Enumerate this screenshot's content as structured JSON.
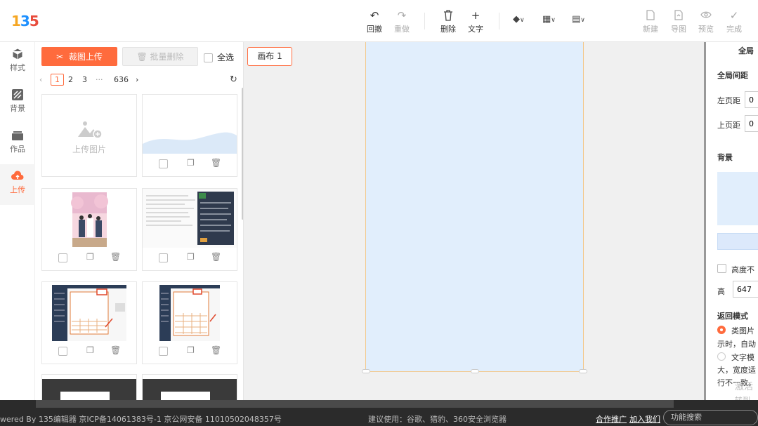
{
  "logo": {
    "text_1": "1",
    "text_2": "3",
    "text_3": "5"
  },
  "toolbar": {
    "undo": "回撤",
    "redo": "重做",
    "delete": "删除",
    "text": "文字",
    "new": "新建",
    "export": "导图",
    "preview": "预览",
    "finish": "完成"
  },
  "leftnav": [
    {
      "label": "样式",
      "icon": "cube-icon"
    },
    {
      "label": "背景",
      "icon": "background-icon"
    },
    {
      "label": "作品",
      "icon": "works-icon"
    },
    {
      "label": "上传",
      "icon": "cloud-upload-icon"
    }
  ],
  "panel": {
    "crop_upload": "裁图上传",
    "batch_delete": "批量删除",
    "select_all": "全选",
    "pager": {
      "pages": [
        "1",
        "2",
        "3"
      ],
      "ellipsis": "···",
      "last": "636",
      "current": "1"
    },
    "upload_placeholder": "上传图片"
  },
  "canvas": {
    "tab_label": "画布 1"
  },
  "right": {
    "title": "全局",
    "spacing_title": "全局间距",
    "left_margin_label": "左页距",
    "left_margin_value": "0",
    "top_margin_label": "上页距",
    "top_margin_value": "0",
    "bg_title": "背景",
    "height_lock_label": "高度不",
    "height_label": "高",
    "height_value": "647",
    "return_mode": "返回模式",
    "mode_image": "类图片",
    "mode_image_desc": "示时，自动",
    "mode_text": "文字模",
    "mode_text_desc1": "大，宽度适",
    "mode_text_desc2": "行不一致。"
  },
  "footer": {
    "powered": "wered By 135编辑器  京ICP备14061383号-1 京公网安备 11010502048357号",
    "suggest": "建议使用：谷歌、猎豹、360安全浏览器",
    "cooperate": "合作推广",
    "join": "加入我们",
    "search": "功能搜索"
  },
  "watermark": {
    "line1": "激活",
    "line2": "转到"
  },
  "colors": {
    "accent": "#ff6b3d",
    "canvas": "#e1eefc"
  }
}
